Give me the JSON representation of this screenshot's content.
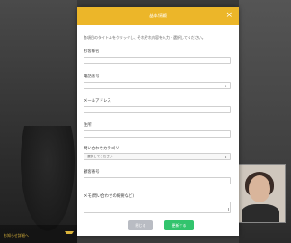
{
  "background": {
    "bottom_label": "お知らせ詳細へ"
  },
  "modal": {
    "title": "基本情報",
    "close_icon": "×",
    "intro": "各項目のタイトルをクリックし、それぞれ内容を入力・選択してください。",
    "fields": [
      {
        "label": "お客様名",
        "value": ""
      },
      {
        "label": "電話番号",
        "value": ""
      },
      {
        "label": "メールアドレス",
        "value": ""
      },
      {
        "label": "住所",
        "value": ""
      },
      {
        "label": "問い合わせカテゴリー",
        "value": "選択してください"
      },
      {
        "label": "顧客番号",
        "value": ""
      },
      {
        "label": "メモ(問い合わせの概要など)",
        "value": ""
      }
    ],
    "stepper_icon": "⇕",
    "select_arrow": "⇕",
    "buttons": {
      "close": "閉じる",
      "update": "更新する"
    }
  },
  "colors": {
    "header": "#ecb629",
    "update_button": "#32c46d",
    "close_button": "#b9bcc3"
  }
}
